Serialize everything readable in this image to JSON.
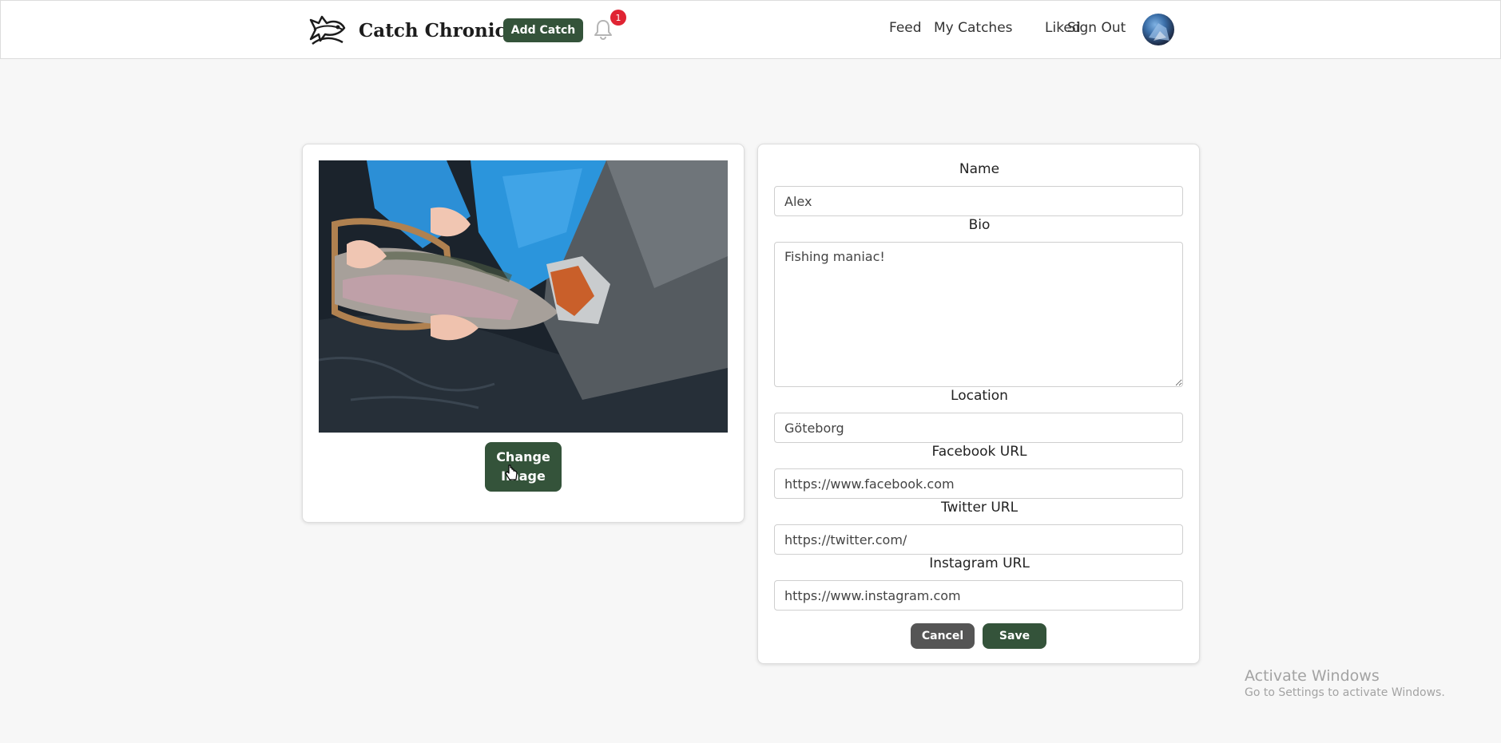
{
  "header": {
    "brand_title": "Catch Chronicle",
    "add_catch_label": "Add Catch",
    "notification_count": "1",
    "nav": {
      "feed": "Feed",
      "my_catches": "My Catches",
      "liked": "Liked",
      "sign_out": "Sign Out"
    },
    "accent_color": "#34533a",
    "badge_color": "#e02433"
  },
  "image_card": {
    "change_image_label": "Change Image"
  },
  "profile_form": {
    "name_label": "Name",
    "name_value": "Alex",
    "bio_label": "Bio",
    "bio_value": "Fishing maniac!",
    "location_label": "Location",
    "location_value": "Göteborg",
    "facebook_label": "Facebook URL",
    "facebook_value": "https://www.facebook.com",
    "twitter_label": "Twitter URL",
    "twitter_value": "https://twitter.com/",
    "instagram_label": "Instagram URL",
    "instagram_value": "https://www.instagram.com",
    "cancel_label": "Cancel",
    "save_label": "Save",
    "cancel_color": "#555555"
  },
  "watermark": {
    "title": "Activate Windows",
    "subtitle": "Go to Settings to activate Windows."
  }
}
